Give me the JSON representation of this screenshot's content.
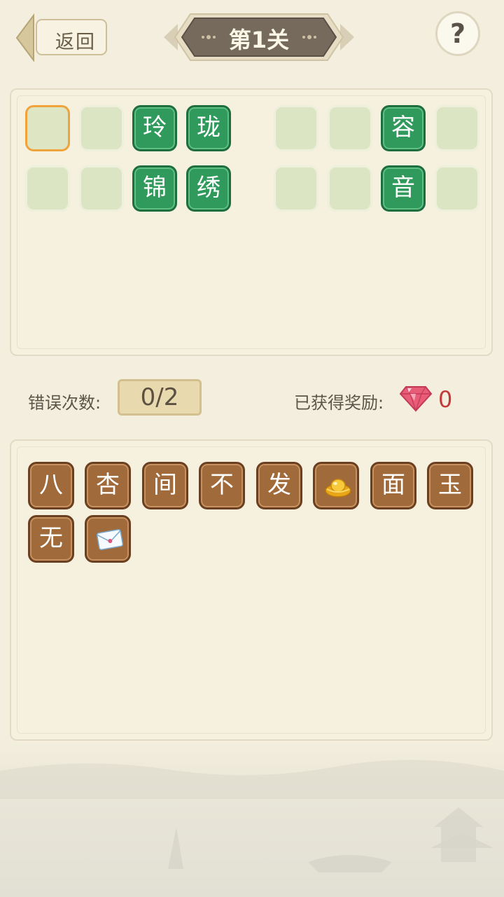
{
  "header": {
    "back_label": "返回",
    "level_title": "第1关",
    "help_label": "?"
  },
  "answer": {
    "rows": [
      {
        "left": [
          {
            "char": "",
            "state": "active"
          },
          {
            "char": "",
            "state": "empty"
          },
          {
            "char": "玲",
            "state": "filled"
          },
          {
            "char": "珑",
            "state": "filled"
          }
        ],
        "right": [
          {
            "char": "",
            "state": "empty"
          },
          {
            "char": "",
            "state": "empty"
          },
          {
            "char": "容",
            "state": "filled"
          },
          {
            "char": "",
            "state": "empty"
          }
        ]
      },
      {
        "left": [
          {
            "char": "",
            "state": "empty"
          },
          {
            "char": "",
            "state": "empty"
          },
          {
            "char": "锦",
            "state": "filled"
          },
          {
            "char": "绣",
            "state": "filled"
          }
        ],
        "right": [
          {
            "char": "",
            "state": "empty"
          },
          {
            "char": "",
            "state": "empty"
          },
          {
            "char": "音",
            "state": "filled"
          },
          {
            "char": "",
            "state": "empty"
          }
        ]
      }
    ]
  },
  "stats": {
    "errors_label": "错误次数:",
    "errors_value": "0/2",
    "reward_label": "已获得奖励:",
    "reward_count": "0",
    "reward_icon": "gem-icon"
  },
  "options": [
    {
      "char": "八"
    },
    {
      "char": "杏"
    },
    {
      "char": "间"
    },
    {
      "char": "不"
    },
    {
      "char": "发"
    },
    {
      "char": "",
      "icon": "gold-ingot-icon"
    },
    {
      "char": "面"
    },
    {
      "char": "玉"
    },
    {
      "char": "无"
    },
    {
      "char": "",
      "icon": "envelope-icon"
    }
  ],
  "colors": {
    "filled_slot": "#2f9a5b",
    "active_slot_border": "#f0a33a",
    "option_tile": "#a06a3a",
    "reward_count": "#c23a3a"
  }
}
